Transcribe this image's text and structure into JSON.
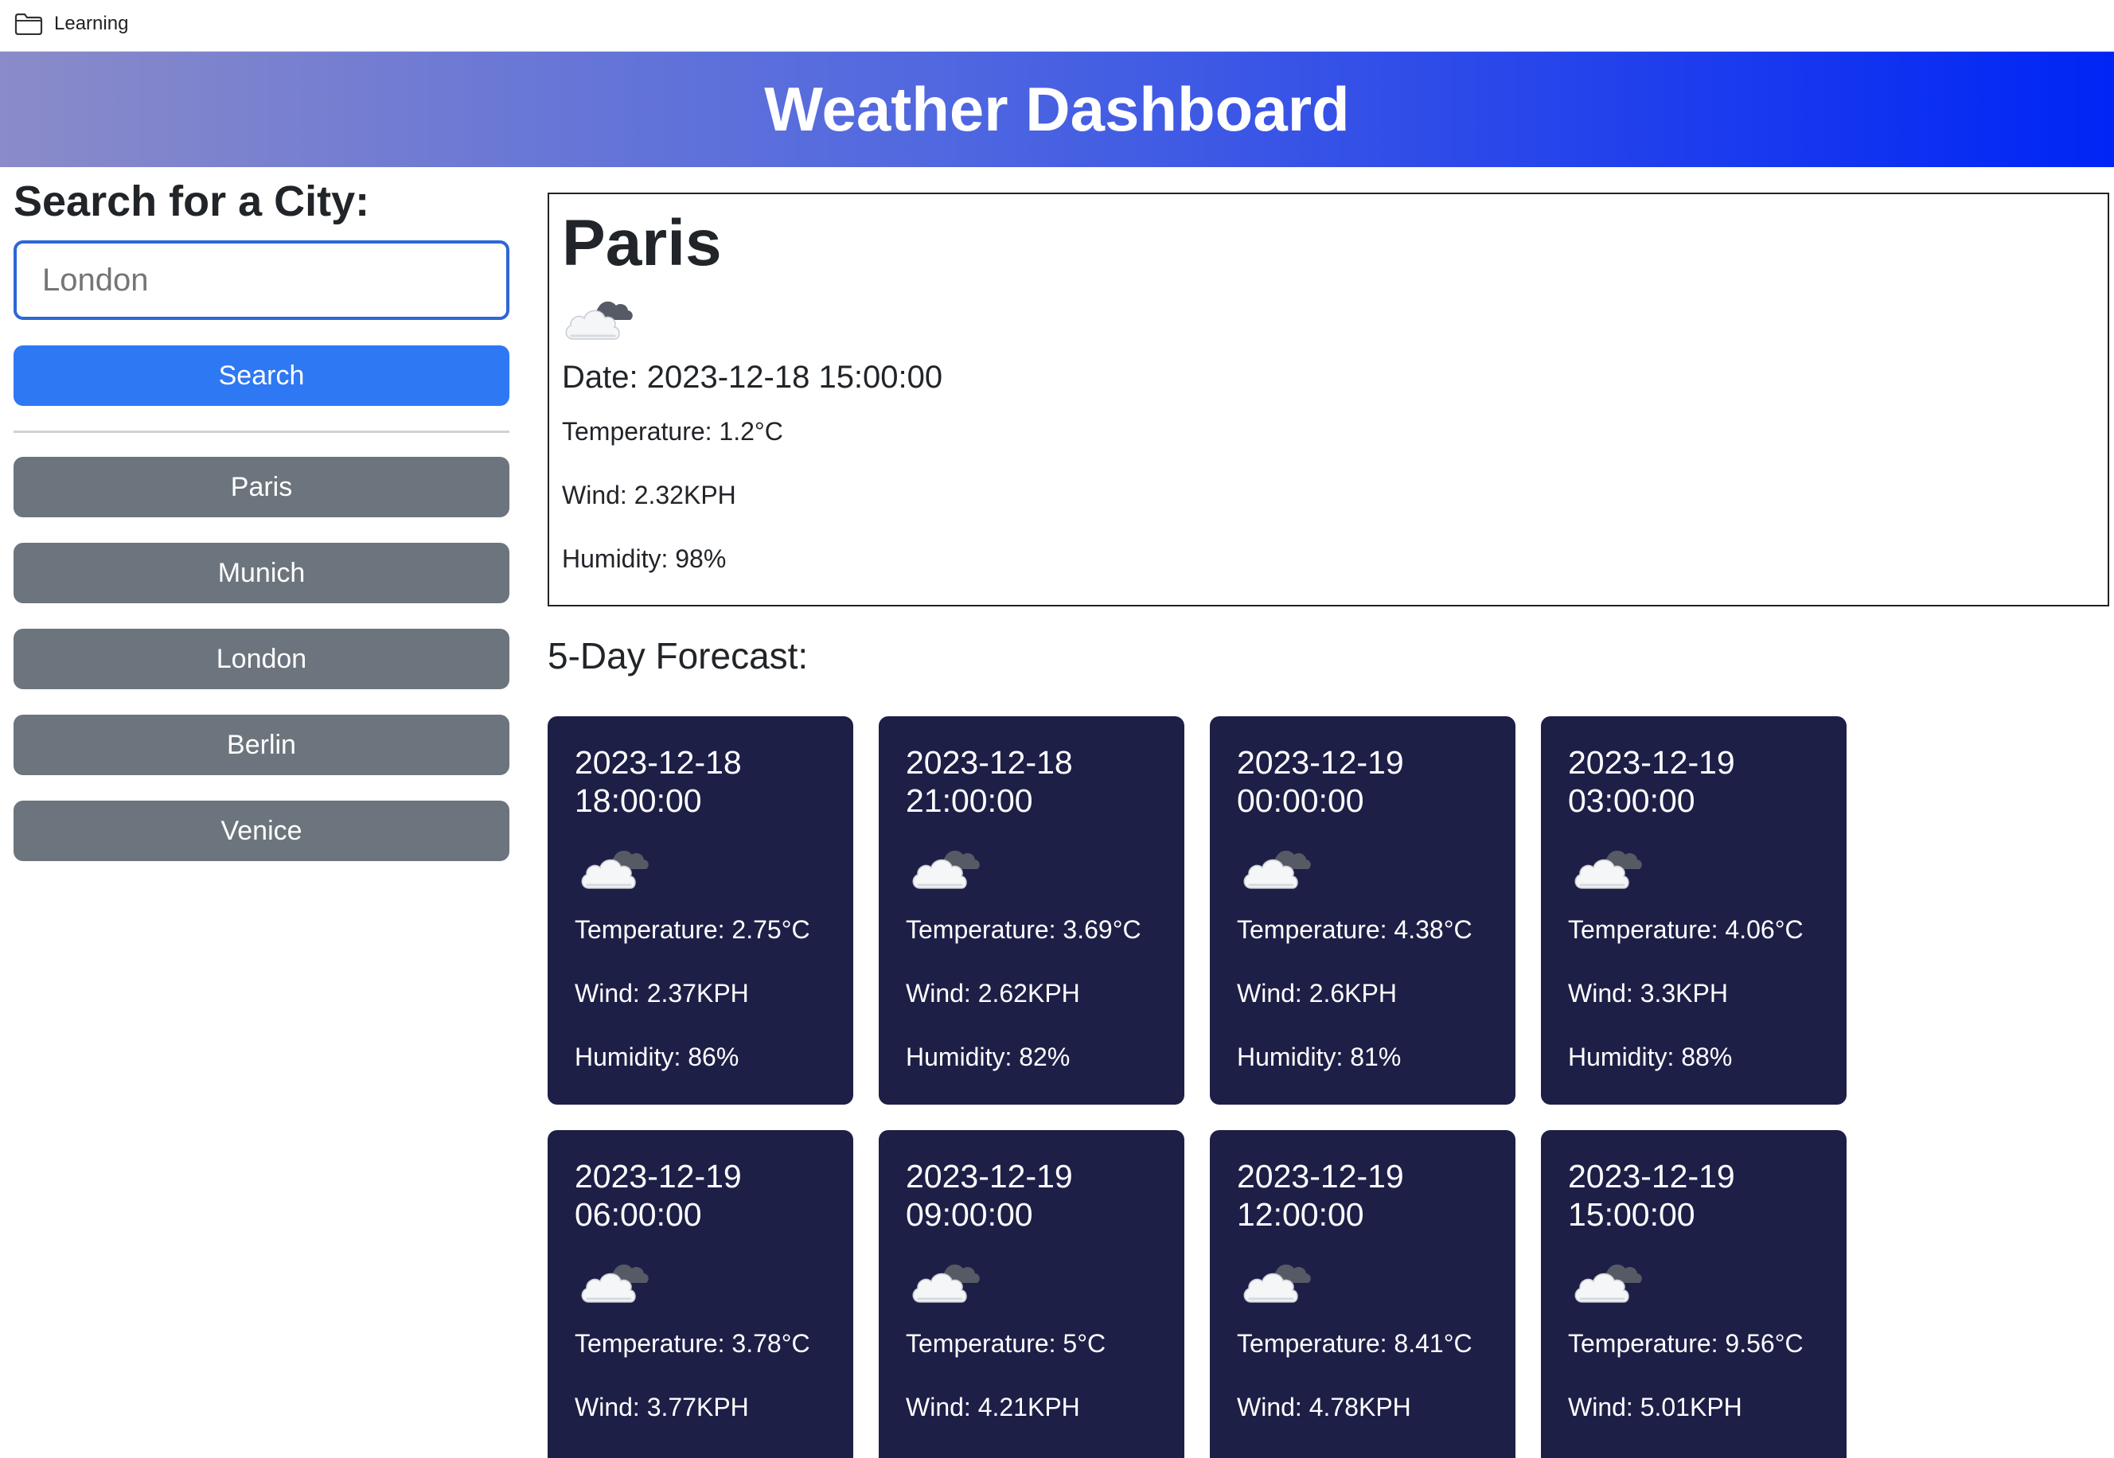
{
  "bookmarks": {
    "items": [
      {
        "label": "Learning",
        "icon": "folder-icon"
      }
    ]
  },
  "header": {
    "title": "Weather Dashboard",
    "gradient_colors": [
      "#8a8bc8",
      "#0025f5"
    ]
  },
  "sidebar": {
    "heading": "Search for a City:",
    "search": {
      "value": "",
      "placeholder": "London"
    },
    "search_button_label": "Search",
    "history": [
      "Paris",
      "Munich",
      "London",
      "Berlin",
      "Venice"
    ]
  },
  "current": {
    "city": "Paris",
    "icon": "cloud-icon",
    "date": "Date: 2023-12-18 15:00:00",
    "temperature": "Temperature: 1.2°C",
    "wind": "Wind: 2.32KPH",
    "humidity": "Humidity: 98%"
  },
  "forecast": {
    "title": "5-Day Forecast:",
    "card_color": "#1e1f47",
    "cards": [
      {
        "date": "2023-12-18 18:00:00",
        "icon": "cloud-icon",
        "temperature": "Temperature: 2.75°C",
        "wind": "Wind: 2.37KPH",
        "humidity": "Humidity: 86%"
      },
      {
        "date": "2023-12-18 21:00:00",
        "icon": "cloud-icon",
        "temperature": "Temperature: 3.69°C",
        "wind": "Wind: 2.62KPH",
        "humidity": "Humidity: 82%"
      },
      {
        "date": "2023-12-19 00:00:00",
        "icon": "cloud-icon",
        "temperature": "Temperature: 4.38°C",
        "wind": "Wind: 2.6KPH",
        "humidity": "Humidity: 81%"
      },
      {
        "date": "2023-12-19 03:00:00",
        "icon": "cloud-icon",
        "temperature": "Temperature: 4.06°C",
        "wind": "Wind: 3.3KPH",
        "humidity": "Humidity: 88%"
      },
      {
        "date": "2023-12-19 06:00:00",
        "icon": "cloud-icon",
        "temperature": "Temperature: 3.78°C",
        "wind": "Wind: 3.77KPH"
      },
      {
        "date": "2023-12-19 09:00:00",
        "icon": "cloud-icon",
        "temperature": "Temperature: 5°C",
        "wind": "Wind: 4.21KPH"
      },
      {
        "date": "2023-12-19 12:00:00",
        "icon": "cloud-icon",
        "temperature": "Temperature: 8.41°C",
        "wind": "Wind: 4.78KPH"
      },
      {
        "date": "2023-12-19 15:00:00",
        "icon": "cloud-icon",
        "temperature": "Temperature: 9.56°C",
        "wind": "Wind: 5.01KPH"
      }
    ]
  }
}
